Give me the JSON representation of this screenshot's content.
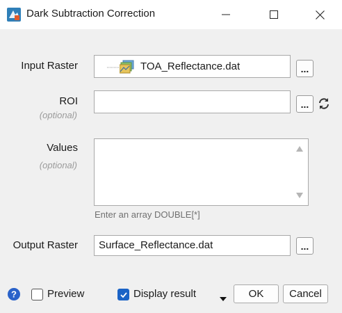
{
  "window": {
    "title": "Dark Subtraction Correction",
    "icon": "envi-app-icon"
  },
  "form": {
    "input_raster": {
      "label": "Input Raster",
      "value": "TOA_Reflectance.dat",
      "browse_label": "..."
    },
    "roi": {
      "label": "ROI",
      "optional_label": "(optional)",
      "value": "",
      "browse_label": "...",
      "refresh_icon": "refresh-icon"
    },
    "values": {
      "label": "Values",
      "optional_label": "(optional)",
      "value": "",
      "hint": "Enter an array DOUBLE[*]"
    },
    "output_raster": {
      "label": "Output Raster",
      "value": "Surface_Reflectance.dat",
      "browse_label": "..."
    }
  },
  "footer": {
    "help_icon": "help-icon",
    "preview": {
      "label": "Preview",
      "checked": false
    },
    "display_result": {
      "label": "Display result",
      "checked": true
    },
    "ok_label": "OK",
    "cancel_label": "Cancel"
  },
  "colors": {
    "accent": "#1a63c6",
    "help": "#2a62c9"
  }
}
